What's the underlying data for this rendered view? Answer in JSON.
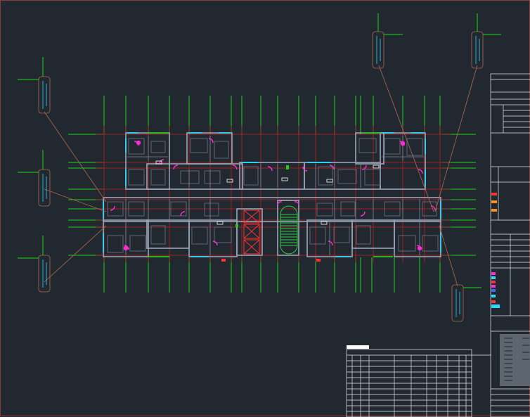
{
  "app": {
    "title": ""
  },
  "colors": {
    "background": "#212830",
    "frame": "#8a3a3a",
    "axis_grid": "#c02020",
    "axis_bubble": "#19d319",
    "wall": "#9aa6b8",
    "window": "#2ad9ff",
    "door": "#ff2bd6",
    "furniture": "#6d7787",
    "stair": "#2ecc40",
    "callout_leader": "#b06a50",
    "title_block": "#e8e8e8",
    "legend_magenta": "#ff2bd6",
    "legend_cyan": "#2ad9ff",
    "legend_red": "#ff3030",
    "legend_blue": "#3a6bff",
    "legend_orange": "#ff8c1a"
  },
  "icons": {
    "detail_callout": "detail-callout-icon",
    "stair": "stair-icon",
    "door_swing": "door-swing-icon"
  }
}
